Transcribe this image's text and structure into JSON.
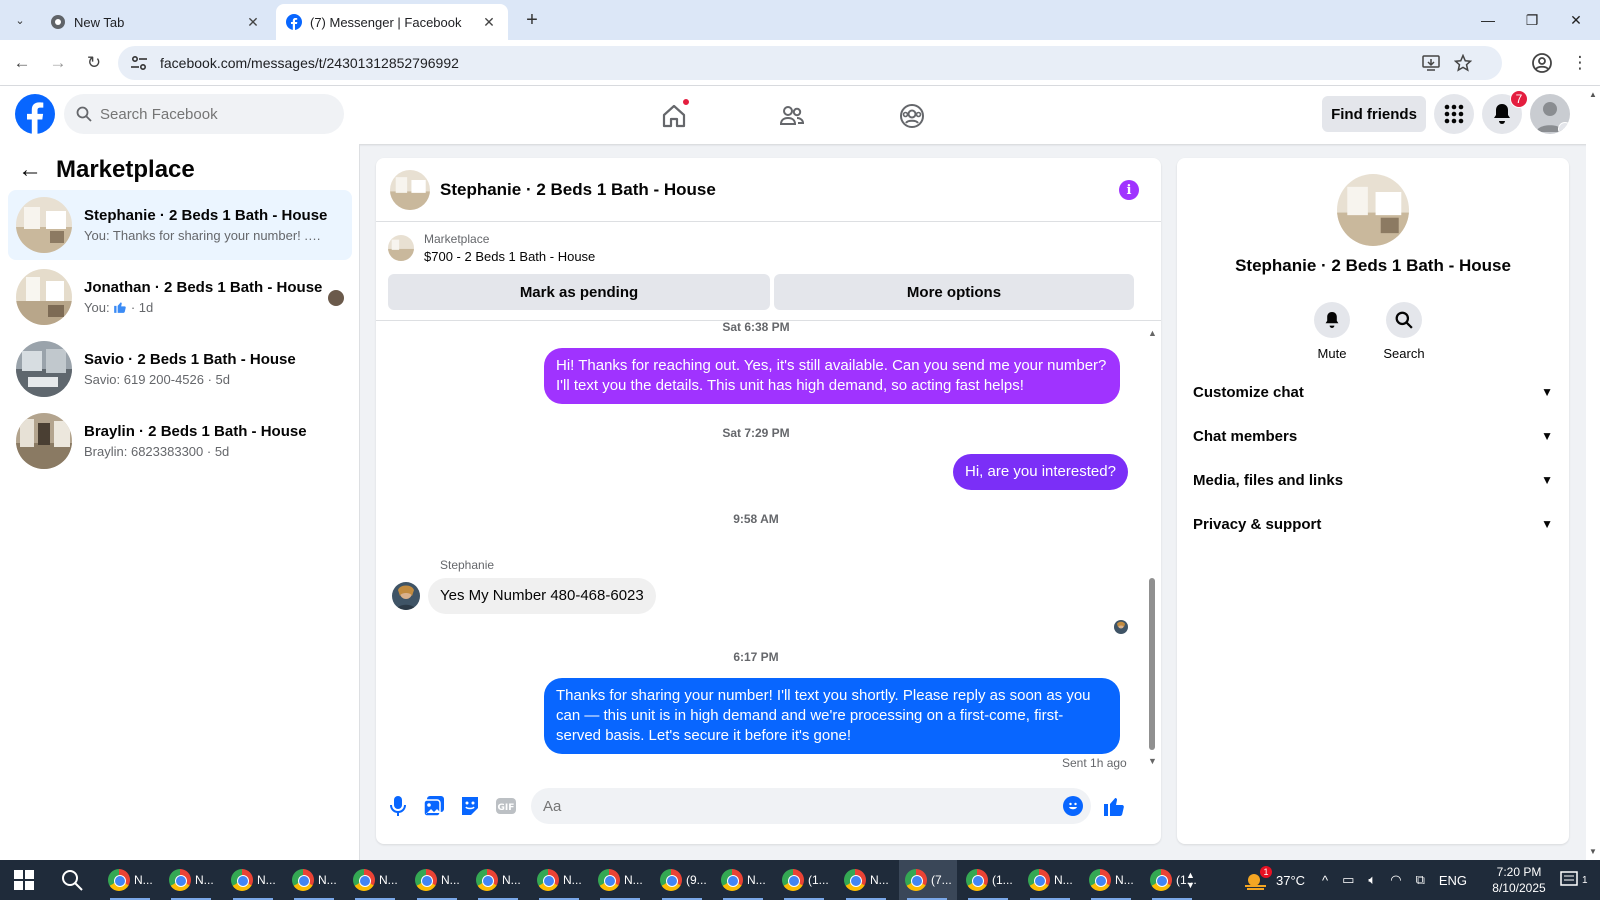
{
  "browser": {
    "tabs": [
      {
        "title": "New Tab",
        "active": false
      },
      {
        "title": "(7) Messenger | Facebook",
        "active": true
      }
    ],
    "url": "facebook.com/messages/t/24301312852796992"
  },
  "fb_header": {
    "search_placeholder": "Search Facebook",
    "find_friends_label": "Find friends",
    "notification_count": "7"
  },
  "sidebar": {
    "title": "Marketplace",
    "conversations": [
      {
        "name": "Stephanie · 2 Beds 1 Bath - House",
        "preview": "You: Thanks for sharing your number! ... · 1h",
        "active": true
      },
      {
        "name": "Jonathan · 2 Beds 1 Bath - House",
        "preview_prefix": "You:",
        "preview_suffix": "· 1d",
        "active": false
      },
      {
        "name": "Savio · 2 Beds 1 Bath - House",
        "preview": "Savio: 619 200-4526 · 5d",
        "active": false
      },
      {
        "name": "Braylin · 2 Beds 1 Bath - House",
        "preview": "Braylin: 6823383300 · 5d",
        "active": false
      }
    ]
  },
  "chat": {
    "title": "Stephanie · 2 Beds 1 Bath - House",
    "marketplace_label": "Marketplace",
    "listing": "$700 - 2 Beds 1 Bath - House",
    "mark_pending_label": "Mark as pending",
    "more_options_label": "More options",
    "timestamps": [
      "Sat 6:38 PM",
      "Sat 7:29 PM",
      "9:58 AM",
      "6:17 PM"
    ],
    "messages": [
      {
        "from": "me",
        "text": "Hi! Thanks for reaching out. Yes, it's still available. Can you send me your number? I'll text you the details. This unit has high demand, so acting fast helps!"
      },
      {
        "from": "me",
        "text": "Hi, are you interested?"
      },
      {
        "from": "Stephanie",
        "text": "Yes My Number 480-468-6023"
      },
      {
        "from": "me",
        "text": "Thanks for sharing your number! I'll text you shortly. Please reply as soon as you can — this unit is in high demand and we're processing on a first-come, first-served basis. Let's secure it before it's gone!"
      }
    ],
    "sender_name": "Stephanie",
    "sent_status": "Sent 1h ago",
    "composer_placeholder": "Aa"
  },
  "right_panel": {
    "name": "Stephanie · 2 Beds 1 Bath - House",
    "mute_label": "Mute",
    "search_label": "Search",
    "sections": [
      "Customize chat",
      "Chat members",
      "Media, files and links",
      "Privacy & support"
    ]
  },
  "taskbar": {
    "apps": [
      "N...",
      "N...",
      "N...",
      "N...",
      "N...",
      "N...",
      "N...",
      "N...",
      "N...",
      "(9...",
      "N...",
      "(1...",
      "N...",
      "(7...",
      "(1...",
      "N...",
      "N...",
      "(1..."
    ],
    "weather": "37°C",
    "weather_badge": "1",
    "language": "ENG",
    "time": "7:20 PM",
    "date": "8/10/2025",
    "notif_count": "1"
  },
  "colors": {
    "fb_blue": "#0866ff",
    "bubble_purple": "#a033ff",
    "bubble_violet": "#7b2ff7",
    "active_conv_bg": "#ebf5ff"
  }
}
